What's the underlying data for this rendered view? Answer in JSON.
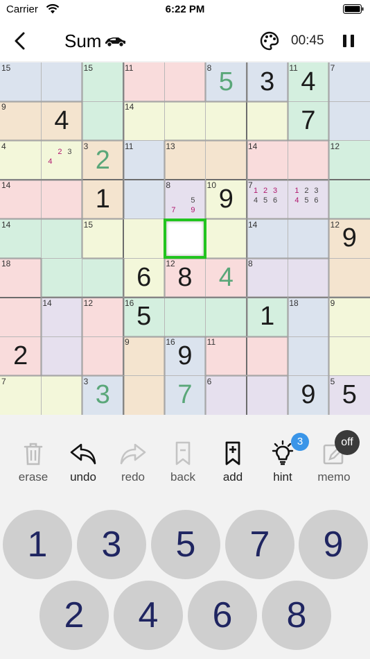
{
  "status": {
    "carrier": "Carrier",
    "time": "6:22 PM"
  },
  "header": {
    "title": "Sum",
    "timer": "00:45"
  },
  "colors": {
    "blue": "#dbe3ee",
    "green": "#d4efdf",
    "pink": "#f9dcdc",
    "yellow": "#f3f7da",
    "tan": "#f4e4cf",
    "lavender": "#e6e0ee",
    "hint_digit": "#5aa779",
    "selection": "#22c41f",
    "key_digit": "#1f2561",
    "note_pink": "#b0176d"
  },
  "board": {
    "grid": [
      [
        "blue",
        "blue",
        "green",
        "pink",
        "pink",
        "blue",
        "blue",
        "green",
        "blue"
      ],
      [
        "tan",
        "tan",
        "green",
        "yellow",
        "yellow",
        "yellow",
        "yellow",
        "green",
        "blue"
      ],
      [
        "yellow",
        "yellow",
        "tan",
        "blue",
        "tan",
        "tan",
        "pink",
        "pink",
        "green"
      ],
      [
        "pink",
        "pink",
        "tan",
        "blue",
        "lavender",
        "yellow",
        "lavender",
        "lavender",
        "green"
      ],
      [
        "green",
        "green",
        "yellow",
        "yellow",
        "white",
        "yellow",
        "blue",
        "blue",
        "tan"
      ],
      [
        "pink",
        "green",
        "green",
        "yellow",
        "pink",
        "pink",
        "lavender",
        "lavender",
        "tan"
      ],
      [
        "pink",
        "lavender",
        "pink",
        "green",
        "green",
        "green",
        "green",
        "blue",
        "yellow"
      ],
      [
        "pink",
        "lavender",
        "pink",
        "tan",
        "blue",
        "pink",
        "pink",
        "blue",
        "yellow"
      ],
      [
        "yellow",
        "yellow",
        "blue",
        "tan",
        "blue",
        "lavender",
        "lavender",
        "blue",
        "lavender"
      ]
    ],
    "cells": [
      {
        "r": 0,
        "c": 0,
        "sum": "15"
      },
      {
        "r": 0,
        "c": 2,
        "sum": "15"
      },
      {
        "r": 0,
        "c": 3,
        "sum": "11"
      },
      {
        "r": 0,
        "c": 5,
        "sum": "8",
        "value": "5",
        "hint": true
      },
      {
        "r": 0,
        "c": 6,
        "value": "3"
      },
      {
        "r": 0,
        "c": 7,
        "sum": "11",
        "value": "4"
      },
      {
        "r": 0,
        "c": 8,
        "sum": "7"
      },
      {
        "r": 1,
        "c": 0,
        "sum": "9"
      },
      {
        "r": 1,
        "c": 1,
        "value": "4"
      },
      {
        "r": 1,
        "c": 3,
        "sum": "14"
      },
      {
        "r": 1,
        "c": 7,
        "value": "7"
      },
      {
        "r": 2,
        "c": 0,
        "sum": "4"
      },
      {
        "r": 2,
        "c": 2,
        "sum": "3",
        "value": "2",
        "hint": true
      },
      {
        "r": 2,
        "c": 3,
        "sum": "11"
      },
      {
        "r": 2,
        "c": 4,
        "sum": "13"
      },
      {
        "r": 2,
        "c": 6,
        "sum": "14"
      },
      {
        "r": 2,
        "c": 8,
        "sum": "12"
      },
      {
        "r": 3,
        "c": 0,
        "sum": "14"
      },
      {
        "r": 3,
        "c": 2,
        "value": "1"
      },
      {
        "r": 3,
        "c": 4,
        "sum": "8"
      },
      {
        "r": 3,
        "c": 5,
        "sum": "10",
        "value": "9"
      },
      {
        "r": 3,
        "c": 6,
        "sum": "7"
      },
      {
        "r": 4,
        "c": 0,
        "sum": "14"
      },
      {
        "r": 4,
        "c": 2,
        "sum": "15"
      },
      {
        "r": 4,
        "c": 6,
        "sum": "14"
      },
      {
        "r": 4,
        "c": 8,
        "sum": "12",
        "value": "9"
      },
      {
        "r": 5,
        "c": 0,
        "sum": "18"
      },
      {
        "r": 5,
        "c": 3,
        "value": "6"
      },
      {
        "r": 5,
        "c": 4,
        "sum": "12",
        "value": "8"
      },
      {
        "r": 5,
        "c": 5,
        "value": "4",
        "hint": true
      },
      {
        "r": 5,
        "c": 6,
        "sum": "8"
      },
      {
        "r": 6,
        "c": 1,
        "sum": "14"
      },
      {
        "r": 6,
        "c": 2,
        "sum": "12"
      },
      {
        "r": 6,
        "c": 3,
        "sum": "16",
        "value": "5"
      },
      {
        "r": 6,
        "c": 6,
        "value": "1"
      },
      {
        "r": 6,
        "c": 7,
        "sum": "18"
      },
      {
        "r": 6,
        "c": 8,
        "sum": "9"
      },
      {
        "r": 7,
        "c": 0,
        "value": "2"
      },
      {
        "r": 7,
        "c": 3,
        "sum": "9"
      },
      {
        "r": 7,
        "c": 4,
        "sum": "16",
        "value": "9"
      },
      {
        "r": 7,
        "c": 5,
        "sum": "11"
      },
      {
        "r": 8,
        "c": 0,
        "sum": "7"
      },
      {
        "r": 8,
        "c": 2,
        "sum": "3",
        "value": "3",
        "hint": true
      },
      {
        "r": 8,
        "c": 4,
        "value": "7",
        "hint": true
      },
      {
        "r": 8,
        "c": 5,
        "sum": "6"
      },
      {
        "r": 8,
        "c": 7,
        "value": "9"
      },
      {
        "r": 8,
        "c": 8,
        "sum": "5",
        "value": "5"
      }
    ],
    "notes": [
      {
        "r": 2,
        "c": 1,
        "items": [
          {
            "d": "2",
            "p": 2,
            "pink": true
          },
          {
            "d": "3",
            "p": 3
          },
          {
            "d": "4",
            "p": 4,
            "pink": true
          }
        ]
      },
      {
        "r": 3,
        "c": 4,
        "items": [
          {
            "d": "5",
            "p": 6
          },
          {
            "d": "7",
            "p": 7,
            "pink": true
          },
          {
            "d": "9",
            "p": 9,
            "pink": true
          }
        ]
      },
      {
        "r": 3,
        "c": 6,
        "items": [
          {
            "d": "1",
            "p": 1,
            "pink": true
          },
          {
            "d": "2",
            "p": 2,
            "pink": true
          },
          {
            "d": "3",
            "p": 3,
            "pink": true
          },
          {
            "d": "4",
            "p": 4
          },
          {
            "d": "5",
            "p": 5
          },
          {
            "d": "6",
            "p": 6
          }
        ]
      },
      {
        "r": 3,
        "c": 7,
        "items": [
          {
            "d": "1",
            "p": 1,
            "pink": true
          },
          {
            "d": "2",
            "p": 2
          },
          {
            "d": "3",
            "p": 3
          },
          {
            "d": "4",
            "p": 4,
            "pink": true
          },
          {
            "d": "5",
            "p": 5
          },
          {
            "d": "6",
            "p": 6
          }
        ]
      }
    ],
    "cage_walls": {
      "h": [
        [
          1,
          0
        ],
        [
          1,
          1
        ],
        [
          1,
          3
        ],
        [
          1,
          4
        ],
        [
          1,
          5
        ],
        [
          1,
          6
        ],
        [
          2,
          0
        ],
        [
          2,
          1
        ],
        [
          2,
          2
        ],
        [
          2,
          4
        ],
        [
          2,
          5
        ],
        [
          2,
          6
        ],
        [
          2,
          7
        ],
        [
          3,
          0
        ],
        [
          3,
          1
        ],
        [
          3,
          6
        ],
        [
          3,
          7
        ],
        [
          4,
          0
        ],
        [
          4,
          1
        ],
        [
          4,
          2
        ],
        [
          4,
          5
        ],
        [
          4,
          6
        ],
        [
          4,
          7
        ],
        [
          4,
          8
        ],
        [
          5,
          0
        ],
        [
          5,
          2
        ],
        [
          5,
          4
        ],
        [
          5,
          5
        ],
        [
          5,
          6
        ],
        [
          5,
          7
        ],
        [
          6,
          1
        ],
        [
          6,
          2
        ],
        [
          6,
          3
        ],
        [
          6,
          4
        ],
        [
          6,
          5
        ],
        [
          6,
          6
        ],
        [
          6,
          7
        ],
        [
          6,
          8
        ],
        [
          7,
          3
        ],
        [
          7,
          4
        ],
        [
          7,
          5
        ],
        [
          7,
          6
        ],
        [
          8,
          0
        ],
        [
          8,
          1
        ],
        [
          8,
          2
        ],
        [
          8,
          5
        ],
        [
          8,
          6
        ]
      ],
      "v": [
        [
          0,
          2
        ],
        [
          0,
          3
        ],
        [
          0,
          5
        ],
        [
          0,
          6
        ],
        [
          0,
          7
        ],
        [
          0,
          8
        ],
        [
          1,
          2
        ],
        [
          1,
          3
        ],
        [
          1,
          7
        ],
        [
          1,
          8
        ],
        [
          2,
          2
        ],
        [
          2,
          3
        ],
        [
          2,
          4
        ],
        [
          2,
          6
        ],
        [
          2,
          8
        ],
        [
          3,
          2
        ],
        [
          3,
          3
        ],
        [
          3,
          4
        ],
        [
          3,
          5
        ],
        [
          3,
          6
        ],
        [
          3,
          8
        ],
        [
          4,
          2
        ],
        [
          4,
          6
        ],
        [
          4,
          8
        ],
        [
          5,
          1
        ],
        [
          5,
          3
        ],
        [
          5,
          4
        ],
        [
          5,
          6
        ],
        [
          5,
          8
        ],
        [
          6,
          1
        ],
        [
          6,
          2
        ],
        [
          6,
          3
        ],
        [
          6,
          6
        ],
        [
          6,
          7
        ],
        [
          6,
          8
        ],
        [
          7,
          1
        ],
        [
          7,
          2
        ],
        [
          7,
          3
        ],
        [
          7,
          4
        ],
        [
          7,
          5
        ],
        [
          7,
          7
        ],
        [
          7,
          8
        ],
        [
          8,
          2
        ],
        [
          8,
          3
        ],
        [
          8,
          4
        ],
        [
          8,
          5
        ],
        [
          8,
          7
        ],
        [
          8,
          8
        ]
      ]
    },
    "selected": {
      "r": 4,
      "c": 4
    }
  },
  "tools": [
    {
      "id": "erase",
      "label": "erase",
      "icon": "trash-icon"
    },
    {
      "id": "undo",
      "label": "undo",
      "icon": "undo-icon"
    },
    {
      "id": "redo",
      "label": "redo",
      "icon": "redo-icon"
    },
    {
      "id": "back",
      "label": "back",
      "icon": "bookmark-icon"
    },
    {
      "id": "add",
      "label": "add",
      "icon": "bookmark-add-icon"
    },
    {
      "id": "hint",
      "label": "hint",
      "icon": "lightbulb-icon"
    },
    {
      "id": "memo",
      "label": "memo",
      "icon": "pencil-icon"
    }
  ],
  "hint_badge": "3",
  "memo_badge": "off",
  "keypad": {
    "row1": [
      "1",
      "3",
      "5",
      "7",
      "9"
    ],
    "row2": [
      "2",
      "4",
      "6",
      "8"
    ]
  }
}
